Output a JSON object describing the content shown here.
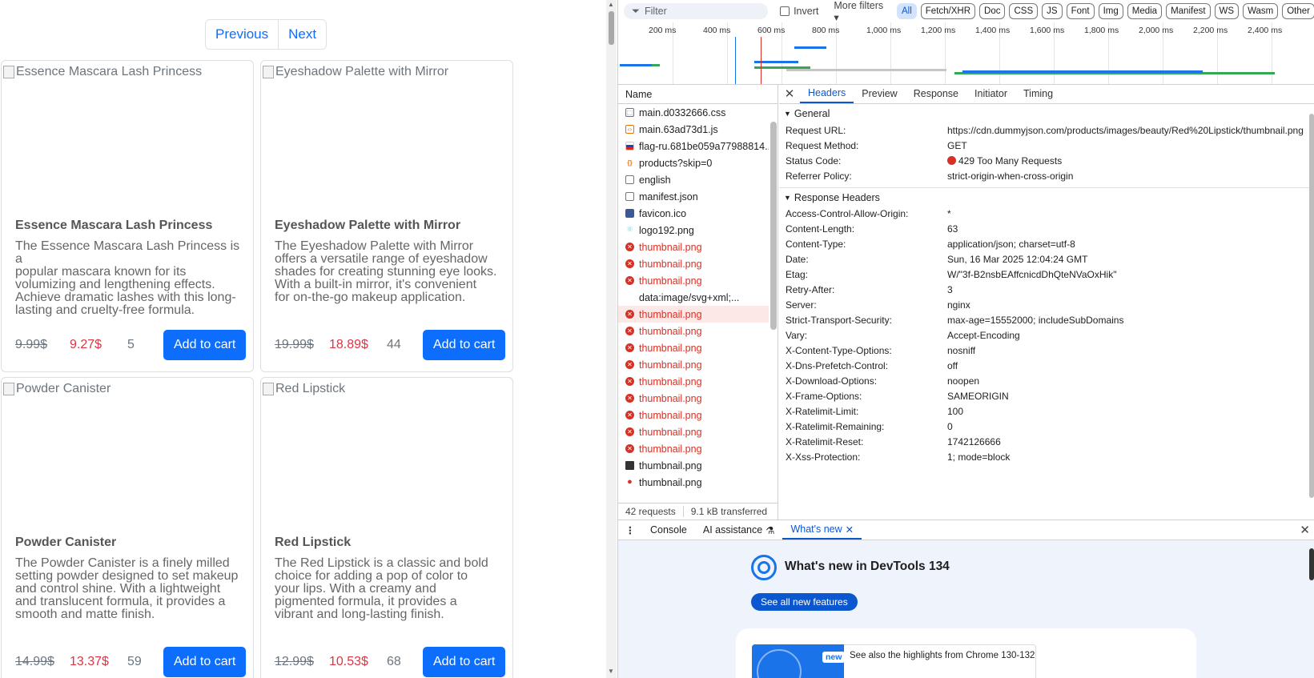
{
  "pager": {
    "previous": "Previous",
    "next": "Next"
  },
  "products": [
    {
      "alt": "Essence Mascara Lash Princess",
      "title": "Essence Mascara Lash Princess",
      "desc_lines": [
        "The Essence Mascara Lash Princess is a",
        "popular mascara known for its",
        "volumizing and lengthening effects.",
        "Achieve dramatic lashes with this long-",
        "lasting and cruelty-free formula."
      ],
      "old_price": "9.99$",
      "new_price": "9.27$",
      "stock": "5",
      "button": "Add to cart"
    },
    {
      "alt": "Eyeshadow Palette with Mirror",
      "title": "Eyeshadow Palette with Mirror",
      "desc_lines": [
        "The Eyeshadow Palette with Mirror",
        "offers a versatile range of eyeshadow",
        "shades for creating stunning eye looks.",
        "With a built-in mirror, it's convenient",
        "for on-the-go makeup application."
      ],
      "old_price": "19.99$",
      "new_price": "18.89$",
      "stock": "44",
      "button": "Add to cart"
    },
    {
      "alt": "Powder Canister",
      "title": "Powder Canister",
      "desc_lines": [
        "The Powder Canister is a finely milled",
        "setting powder designed to set makeup",
        "and control shine. With a lightweight",
        "and translucent formula, it provides a",
        "smooth and matte finish."
      ],
      "old_price": "14.99$",
      "new_price": "13.37$",
      "stock": "59",
      "button": "Add to cart"
    },
    {
      "alt": "Red Lipstick",
      "title": "Red Lipstick",
      "desc_lines": [
        "The Red Lipstick is a classic and bold",
        "choice for adding a pop of color to",
        "your lips. With a creamy and",
        "pigmented formula, it provides a",
        "vibrant and long-lasting finish."
      ],
      "old_price": "12.99$",
      "new_price": "10.53$",
      "stock": "68",
      "button": "Add to cart"
    }
  ],
  "devtools": {
    "filter": {
      "placeholder": "Filter",
      "invert": "Invert",
      "more_filters": "More filters",
      "chips": [
        "All",
        "Fetch/XHR",
        "Doc",
        "CSS",
        "JS",
        "Font",
        "Img",
        "Media",
        "Manifest",
        "WS",
        "Wasm",
        "Other"
      ]
    },
    "timeline_ticks": [
      "200 ms",
      "400 ms",
      "600 ms",
      "800 ms",
      "1,000 ms",
      "1,200 ms",
      "1,400 ms",
      "1,600 ms",
      "1,800 ms",
      "2,000 ms",
      "2,200 ms",
      "2,400 ms"
    ],
    "name_header": "Name",
    "requests": [
      {
        "name": "main.d0332666.css",
        "icon": "css-file-icon",
        "error": false
      },
      {
        "name": "main.63ad73d1.js",
        "icon": "js-file-icon",
        "error": false
      },
      {
        "name": "flag-ru.681be059a77988814...",
        "icon": "flag-icon",
        "error": false
      },
      {
        "name": "products?skip=0",
        "icon": "fetch-icon",
        "error": false
      },
      {
        "name": "english",
        "icon": "document-icon",
        "error": false
      },
      {
        "name": "manifest.json",
        "icon": "document-icon",
        "error": false
      },
      {
        "name": "favicon.ico",
        "icon": "image-icon",
        "error": false
      },
      {
        "name": "logo192.png",
        "icon": "react-icon",
        "error": false
      },
      {
        "name": "thumbnail.png",
        "icon": "error-icon",
        "error": true
      },
      {
        "name": "thumbnail.png",
        "icon": "error-icon",
        "error": true
      },
      {
        "name": "thumbnail.png",
        "icon": "error-icon",
        "error": true
      },
      {
        "name": "data:image/svg+xml;...",
        "icon": "blank-icon",
        "error": false
      },
      {
        "name": "thumbnail.png",
        "icon": "error-icon",
        "error": true,
        "selected": true
      },
      {
        "name": "thumbnail.png",
        "icon": "error-icon",
        "error": true
      },
      {
        "name": "thumbnail.png",
        "icon": "error-icon",
        "error": true
      },
      {
        "name": "thumbnail.png",
        "icon": "error-icon",
        "error": true
      },
      {
        "name": "thumbnail.png",
        "icon": "error-icon",
        "error": true
      },
      {
        "name": "thumbnail.png",
        "icon": "error-icon",
        "error": true
      },
      {
        "name": "thumbnail.png",
        "icon": "error-icon",
        "error": true
      },
      {
        "name": "thumbnail.png",
        "icon": "error-icon",
        "error": true
      },
      {
        "name": "thumbnail.png",
        "icon": "error-icon",
        "error": true
      },
      {
        "name": "thumbnail.png",
        "icon": "image-dark-icon",
        "error": false
      },
      {
        "name": "thumbnail.png",
        "icon": "pin-icon",
        "error": false
      }
    ],
    "summary": {
      "requests": "42 requests",
      "transferred": "9.1 kB transferred"
    },
    "tabs": [
      "Headers",
      "Preview",
      "Response",
      "Initiator",
      "Timing"
    ],
    "general": {
      "title": "General",
      "rows": [
        {
          "k": "Request URL:",
          "v": "https://cdn.dummyjson.com/products/images/beauty/Red%20Lipstick/thumbnail.png"
        },
        {
          "k": "Request Method:",
          "v": "GET"
        },
        {
          "k": "Status Code:",
          "v": "429 Too Many Requests",
          "status": true
        },
        {
          "k": "Referrer Policy:",
          "v": "strict-origin-when-cross-origin"
        }
      ]
    },
    "response_headers": {
      "title": "Response Headers",
      "rows": [
        {
          "k": "Access-Control-Allow-Origin:",
          "v": "*"
        },
        {
          "k": "Content-Length:",
          "v": "63"
        },
        {
          "k": "Content-Type:",
          "v": "application/json; charset=utf-8"
        },
        {
          "k": "Date:",
          "v": "Sun, 16 Mar 2025 12:04:24 GMT"
        },
        {
          "k": "Etag:",
          "v": "W/\"3f-B2nsbEAffcnicdDhQteNVaOxHik\""
        },
        {
          "k": "Retry-After:",
          "v": "3"
        },
        {
          "k": "Server:",
          "v": "nginx"
        },
        {
          "k": "Strict-Transport-Security:",
          "v": "max-age=15552000; includeSubDomains"
        },
        {
          "k": "Vary:",
          "v": "Accept-Encoding"
        },
        {
          "k": "X-Content-Type-Options:",
          "v": "nosniff"
        },
        {
          "k": "X-Dns-Prefetch-Control:",
          "v": "off"
        },
        {
          "k": "X-Download-Options:",
          "v": "noopen"
        },
        {
          "k": "X-Frame-Options:",
          "v": "SAMEORIGIN"
        },
        {
          "k": "X-Ratelimit-Limit:",
          "v": "100"
        },
        {
          "k": "X-Ratelimit-Remaining:",
          "v": "0"
        },
        {
          "k": "X-Ratelimit-Reset:",
          "v": "1742126666"
        },
        {
          "k": "X-Xss-Protection:",
          "v": "1; mode=block"
        }
      ]
    },
    "drawer": {
      "tabs": [
        "Console",
        "AI assistance",
        "What's new"
      ],
      "active": "What's new"
    },
    "whats_new": {
      "title": "What's new in DevTools 134",
      "button": "See all new features",
      "badge": "new",
      "highlight": "See also the highlights from Chrome 130-132"
    },
    "colors": {
      "accent": "#0b57d0",
      "error": "#d93025",
      "primary_button": "#0d6efd",
      "sale_price": "#dc3545"
    }
  }
}
